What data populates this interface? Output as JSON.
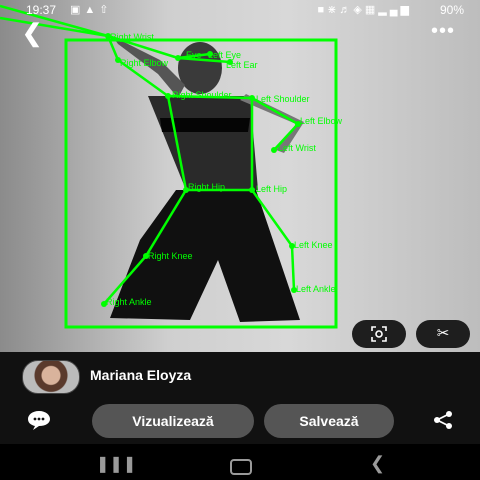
{
  "status_bar": {
    "time": "19:37",
    "left_icons": [
      "photo-icon",
      "drive-icon",
      "arrow-icon"
    ],
    "right_icons": [
      "lock-icon",
      "bluetooth-icon",
      "volume-icon",
      "wifi-icon",
      "volte-icon",
      "signal-icon"
    ],
    "battery": "90%"
  },
  "pose_overlay": {
    "color": "#00ff00",
    "labels": {
      "right_wrist": "Right Wrist",
      "right_elbow": "Right Elbow",
      "eyes": "Eye",
      "left_eye": "Left Eye",
      "left_ear": "Left Ear",
      "right_shoulder": "Right Shoulder",
      "left_shoulder": "Left Shoulder",
      "left_elbow": "Left Elbow",
      "left_wrist": "Left Wrist",
      "right_hip": "Right Hip",
      "left_hip": "Left Hip",
      "left_knee": "Left Knee",
      "right_knee": "Right Knee",
      "left_ankle": "Left Ankle",
      "right_ankle": "Right Ankle"
    }
  },
  "photo_buttons": {
    "lens_icon": "lens-search-icon",
    "scissors_icon": "scissors-icon"
  },
  "profile": {
    "name": "Mariana Eloyza"
  },
  "actions": {
    "view_label": "Vizualizează",
    "save_label": "Salvează"
  },
  "colors": {
    "overlay": "#00ff00",
    "pill": "#555555",
    "bar": "#111111"
  }
}
